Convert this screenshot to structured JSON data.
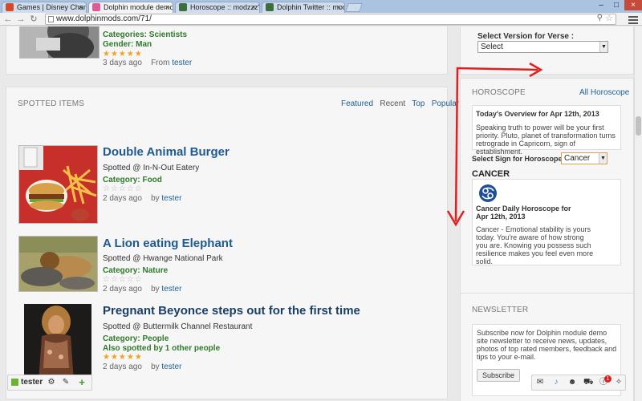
{
  "browser": {
    "tabs": [
      {
        "label": "Games | Disney Channel",
        "favicon_color": "#d9472b"
      },
      {
        "label": "Dolphin module demo site",
        "favicon_color": "#e05a9a"
      },
      {
        "label": "Horoscope :: modzzz's pr",
        "favicon_color": "#3c6f3c"
      },
      {
        "label": "Dolphin Twitter :: modzz",
        "favicon_color": "#3c6f3c"
      }
    ],
    "url": "www.dolphinmods.com/71/"
  },
  "top_item": {
    "category_label": "Categories:",
    "category_value": "Scientists",
    "gender_label": "Gender:",
    "gender_value": "Man",
    "date": "3 days ago",
    "from_label": "From",
    "author": "tester"
  },
  "spotted": {
    "title": "SPOTTED ITEMS",
    "filters": [
      "Featured",
      "Recent",
      "Top",
      "Popular"
    ],
    "items": [
      {
        "title": "Double Animal Burger",
        "spotted_prefix": "Spotted @",
        "location": "In-N-Out Eatery",
        "category_label": "Category:",
        "category": "Food",
        "date": "2 days ago",
        "by_label": "by",
        "author": "tester",
        "rating": 0
      },
      {
        "title": "A Lion eating Elephant",
        "spotted_prefix": "Spotted @",
        "location": "Hwange National Park",
        "category_label": "Category:",
        "category": "Nature",
        "date": "2 days ago",
        "by_label": "by",
        "author": "tester",
        "rating": 0
      },
      {
        "title": "Pregnant Beyonce steps out for the first time",
        "spotted_prefix": "Spotted @",
        "location": "Buttermilk Channel Restaurant",
        "category_label": "Category:",
        "category": "People",
        "also_spotted": "Also spotted by 1 other people",
        "date": "2 days ago",
        "by_label": "by",
        "author": "tester",
        "rating": 5
      }
    ]
  },
  "verse": {
    "label": "Select Version for Verse :",
    "selected": "Select"
  },
  "horoscope": {
    "title": "HOROSCOPE",
    "all_link": "All Horoscope",
    "overview_title": "Today's Overview for Apr 12th, 2013",
    "overview_text": "Speaking truth to power will be your first priority. Pluto, planet of transformation turns retrograde in Capricorn, sign of establishment.",
    "select_label": "Select Sign for Horoscope :",
    "selected_sign": "Cancer",
    "sign_heading": "CANCER",
    "daily_title": "Cancer Daily Horoscope for Apr 12th, 2013",
    "daily_text": "Cancer - Emotional stability is yours today. You're aware of how strong you are. Knowing you possess such resilience makes you feel even more solid."
  },
  "newsletter": {
    "title": "NEWSLETTER",
    "text": "Subscribe now for Dolphin module demo site newsletter to receive news, updates, photos of top rated members, feedback and tips to your e-mail.",
    "button": "Subscribe"
  },
  "user_menu": {
    "username": "tester"
  },
  "notifications": {
    "badge_count": "1"
  },
  "colors": {
    "link": "#1d5f94",
    "category": "#2f7a2a",
    "star": "#f3a31b",
    "annotation_arrow": "#e02020"
  }
}
